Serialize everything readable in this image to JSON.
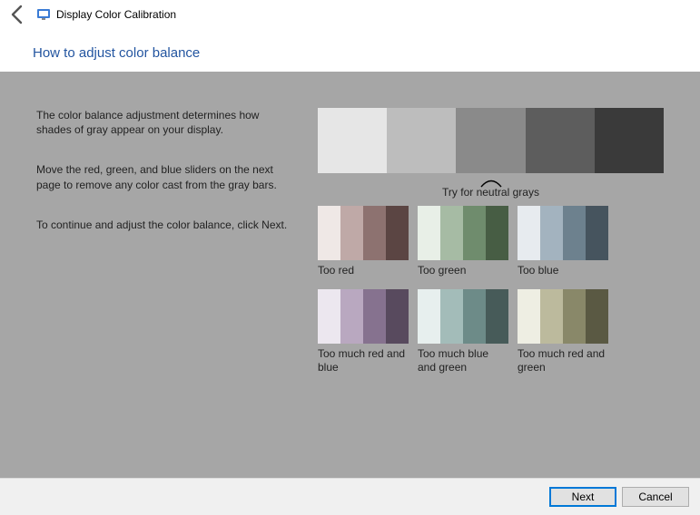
{
  "titlebar": {
    "title": "Display Color Calibration"
  },
  "heading": "How to adjust color balance",
  "instructions": {
    "p1": "The color balance adjustment determines how shades of gray appear on your display.",
    "p2": "Move the red, green, and blue sliders on the next page to remove any color cast from the gray bars.",
    "p3": "To continue and adjust the color balance, click Next."
  },
  "neutral": {
    "caption": "Try for neutral grays",
    "s0": "background:#e6e6e6",
    "s1": "background:#bdbdbd",
    "s2": "background:#8a8a8a",
    "s3": "background:#5d5d5d",
    "s4": "background:#3a3a3a"
  },
  "examples": [
    {
      "label": "Too red",
      "c0": "background:#efe8e6",
      "c1": "background:#bfa9a7",
      "c2": "background:#8d7270",
      "c3": "background:#5b4543"
    },
    {
      "label": "Too green",
      "c0": "background:#e8efe7",
      "c1": "background:#a6bba4",
      "c2": "background:#6f8c6d",
      "c3": "background:#475d44"
    },
    {
      "label": "Too blue",
      "c0": "background:#e7ebef",
      "c1": "background:#a3b3bf",
      "c2": "background:#6d818e",
      "c3": "background:#46545e"
    },
    {
      "label": "Too much red and blue",
      "c0": "background:#ece7ef",
      "c1": "background:#b9a8c0",
      "c2": "background:#86728f",
      "c3": "background:#584a5e"
    },
    {
      "label": "Too much blue and green",
      "c0": "background:#e7efee",
      "c1": "background:#a3bcb9",
      "c2": "background:#6d8b88",
      "c3": "background:#475b59"
    },
    {
      "label": "Too much red and green",
      "c0": "background:#eeeee3",
      "c1": "background:#bcba9d",
      "c2": "background:#898869",
      "c3": "background:#5a5943"
    }
  ],
  "footer": {
    "next": "Next",
    "cancel": "Cancel"
  }
}
